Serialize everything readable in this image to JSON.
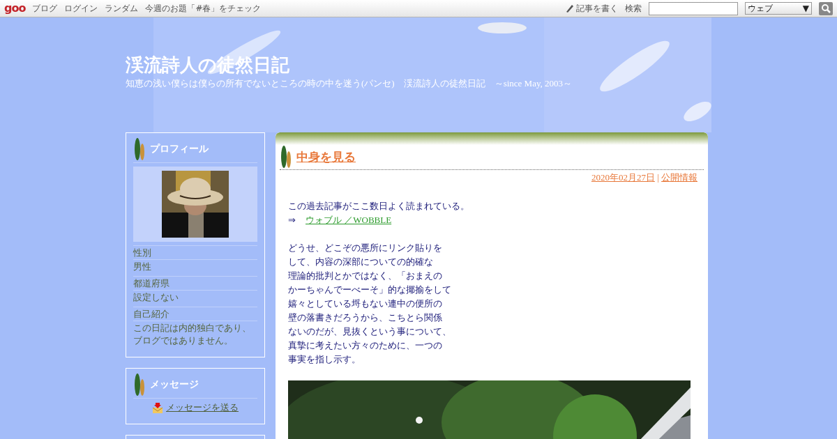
{
  "topbar": {
    "logo": "goo",
    "links": [
      "ブログ",
      "ログイン",
      "ランダム",
      "今週のお題「#春」をチェック"
    ],
    "write": "記事を書く",
    "search_label": "検索",
    "scope": "ウェブ",
    "scope_caret": "▼"
  },
  "header": {
    "title": "渓流詩人の徒然日記",
    "subtitle": "知恵の浅い僕らは僕らの所有でないところの時の中を迷う(パンセ)　渓流詩人の徒然日記　～since May, 2003～"
  },
  "sidebar": {
    "profile": {
      "title": "プロフィール",
      "fields": [
        {
          "label": "性別",
          "value": "男性"
        },
        {
          "label": "都道府県",
          "value": "設定しない"
        },
        {
          "label": "自己紹介",
          "value": "この日記は内的独白であり、ブログではありません。"
        }
      ]
    },
    "message": {
      "title": "メッセージ",
      "link": "メッセージを送る"
    }
  },
  "post": {
    "title": "中身を見る",
    "date": "2020年02月27日",
    "separator": "|",
    "category": "公開情報",
    "intro": "この過去記事がここ数日よく読まれている。",
    "arrow": "⇒",
    "link": "ウォブル ／WOBBLE",
    "paragraph": [
      "どうせ、どこぞの悪所にリンク貼りを",
      "して、内容の深部についての的確な",
      "理論的批判とかではなく、「おまえの",
      "かーちゃんでーべーそ」的な揶揄をして",
      "嬉々としている埒もない連中の便所の",
      "壁の落書きだろうから、こちとら関係",
      "ないのだが、見抜くという事について、",
      "真摯に考えたい方々のために、一つの",
      "事実を指し示す。"
    ]
  }
}
